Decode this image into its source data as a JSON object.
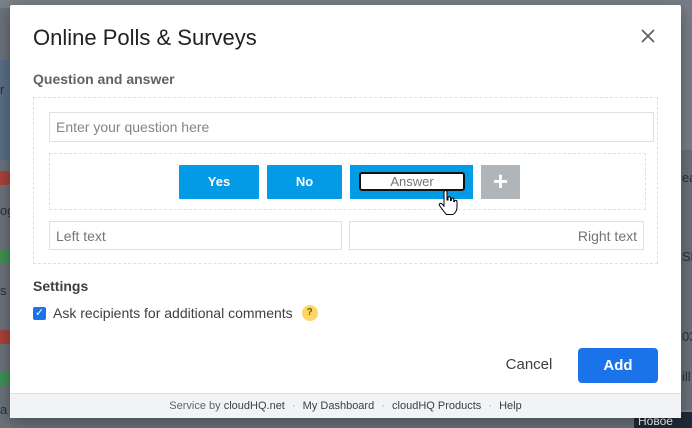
{
  "dialog": {
    "title": "Online Polls & Surveys",
    "close_icon": "close-icon"
  },
  "question_section": {
    "label": "Question and answer",
    "question_placeholder": "Enter your question here",
    "answers": [
      {
        "label": "Yes"
      },
      {
        "label": "No"
      }
    ],
    "new_answer_placeholder": "Answer",
    "add_answer_symbol": "+",
    "left_text_placeholder": "Left text",
    "right_text_placeholder": "Right text"
  },
  "settings": {
    "label": "Settings",
    "comments_checkbox": {
      "label": "Ask recipients for additional comments",
      "checked": true,
      "check_glyph": "✓"
    },
    "help_glyph": "?"
  },
  "actions": {
    "cancel_label": "Cancel",
    "add_label": "Add"
  },
  "footer": {
    "service_prefix": "Service by",
    "service_link": "cloudHQ.net",
    "dashboard_link": "My Dashboard",
    "products_link": "cloudHQ Products",
    "help_link": "Help",
    "separator": "·"
  },
  "background": {
    "partial_texts": [
      "r",
      "og",
      "s r",
      "a",
      "ea",
      "Sh",
      "03",
      "ill"
    ],
    "dark_tab": "Новое"
  },
  "colors": {
    "primary": "#1a73e8",
    "answer_button": "#039be5",
    "help_badge": "#fdd663"
  }
}
